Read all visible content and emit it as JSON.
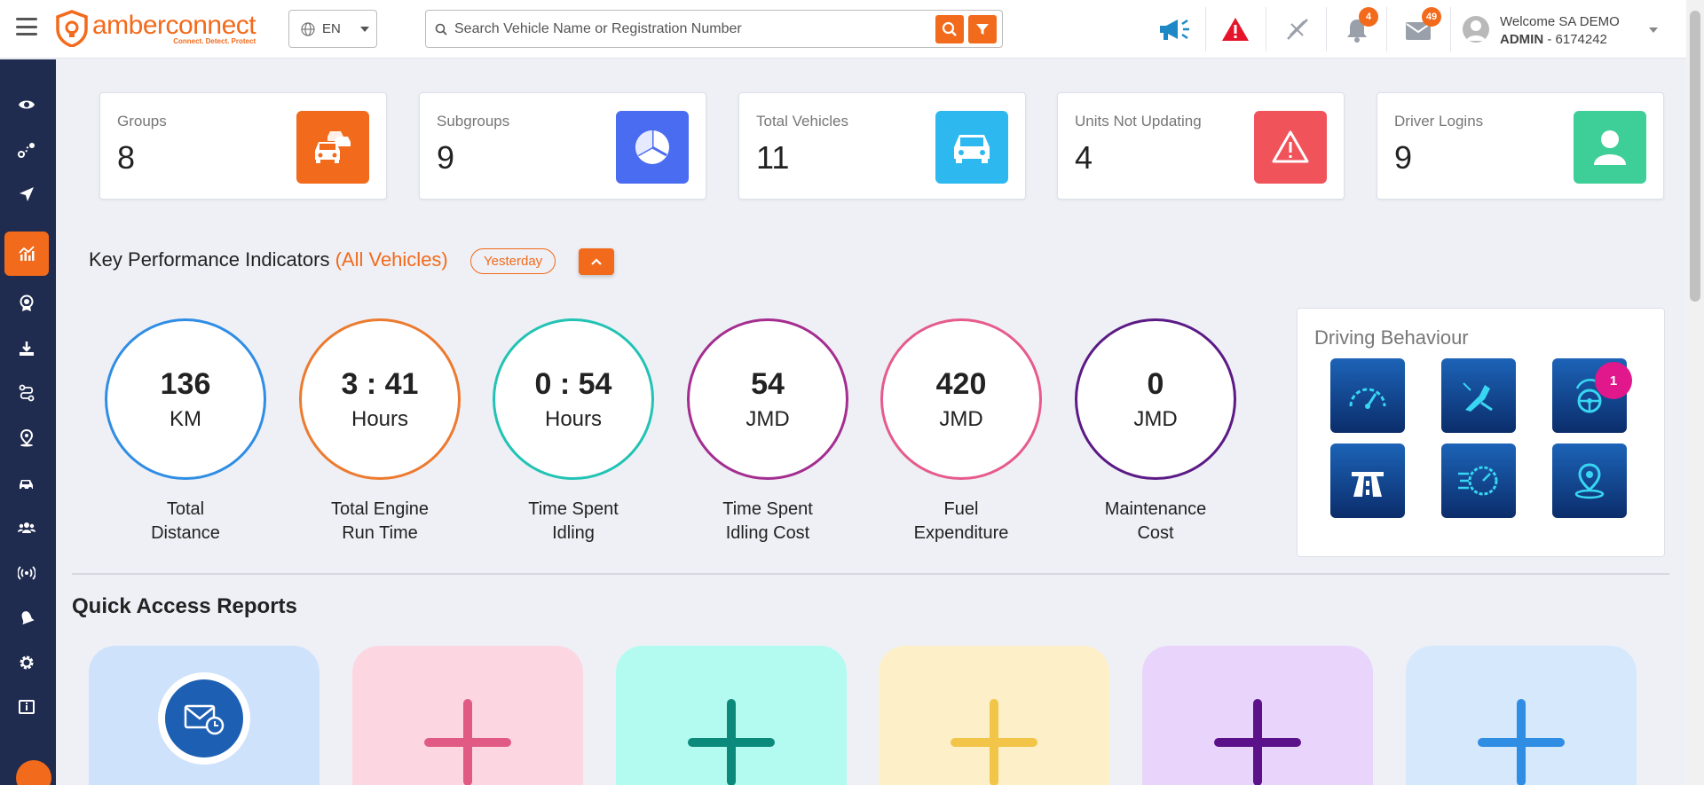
{
  "header": {
    "logo_name": "amberconnect",
    "logo_tagline": "Connect. Detect. Protect",
    "language": "EN",
    "search_placeholder": "Search Vehicle Name or Registration Number",
    "notifications_count": "4",
    "messages_count": "49",
    "user_welcome": "Welcome SA DEMO",
    "user_role": "ADMIN",
    "user_id": " - 6174242"
  },
  "sidebar": {
    "items": [
      {
        "icon": "eye-icon"
      },
      {
        "icon": "route-icon"
      },
      {
        "icon": "navigation-icon"
      },
      {
        "icon": "dashboard-chart-icon",
        "active": true
      },
      {
        "icon": "badge-icon"
      },
      {
        "icon": "download-icon"
      },
      {
        "icon": "trip-icon"
      },
      {
        "icon": "location-pin-icon"
      },
      {
        "icon": "vehicle-icon"
      },
      {
        "icon": "users-icon"
      },
      {
        "icon": "broadcast-icon"
      },
      {
        "icon": "alert-bell-icon"
      },
      {
        "icon": "settings-icon"
      },
      {
        "icon": "info-icon"
      }
    ]
  },
  "stats": [
    {
      "label": "Groups",
      "value": "8",
      "color": "#f26a1b",
      "icon": "cars-icon"
    },
    {
      "label": "Subgroups",
      "value": "9",
      "color": "#4a6cf0",
      "icon": "pie-icon"
    },
    {
      "label": "Total Vehicles",
      "value": "11",
      "color": "#2db9ef",
      "icon": "car-icon"
    },
    {
      "label": "Units Not Updating",
      "value": "4",
      "color": "#f0535a",
      "icon": "warning-icon"
    },
    {
      "label": "Driver Logins",
      "value": "9",
      "color": "#3ecf98",
      "icon": "person-icon"
    }
  ],
  "kpi": {
    "title": "Key Performance Indicators",
    "scope": "(All Vehicles)",
    "period": "Yesterday",
    "items": [
      {
        "value": "136",
        "unit": "KM",
        "label1": "Total",
        "label2": "Distance",
        "color": "#2f8de4"
      },
      {
        "value": "3 : 41",
        "unit": "Hours",
        "label1": "Total Engine",
        "label2": "Run Time",
        "color": "#ec7a2f"
      },
      {
        "value": "0 : 54",
        "unit": "Hours",
        "label1": "Time Spent",
        "label2": "Idling",
        "color": "#22c3b4"
      },
      {
        "value": "54",
        "unit": "JMD",
        "label1": "Time Spent",
        "label2": "Idling Cost",
        "color": "#a42d8f"
      },
      {
        "value": "420",
        "unit": "JMD",
        "label1": "Fuel",
        "label2": "Expenditure",
        "color": "#e65b8b"
      },
      {
        "value": "0",
        "unit": "JMD",
        "label1": "Maintenance",
        "label2": "Cost",
        "color": "#5b1a86"
      }
    ]
  },
  "driving_behaviour": {
    "title": "Driving Behaviour",
    "tiles": [
      {
        "icon": "speedometer-icon"
      },
      {
        "icon": "harsh-braking-icon"
      },
      {
        "icon": "harsh-cornering-icon",
        "badge": "1"
      },
      {
        "icon": "highway-icon"
      },
      {
        "icon": "acceleration-icon"
      },
      {
        "icon": "geofence-icon"
      }
    ]
  },
  "quick_access": {
    "title": "Quick Access Reports",
    "cards": [
      {
        "bg": "#cfe2fc",
        "icon": "scheduled-mail-icon"
      },
      {
        "bg": "#fcd7e2",
        "icon": "plus-icon",
        "color": "#e05a84"
      },
      {
        "bg": "#b3fbf0",
        "icon": "plus-icon",
        "color": "#0b8a7c"
      },
      {
        "bg": "#fdf0c8",
        "icon": "plus-icon",
        "color": "#f2c548"
      },
      {
        "bg": "#e9d5fb",
        "icon": "plus-icon",
        "color": "#5a1189"
      },
      {
        "bg": "#d6e8fc",
        "icon": "plus-icon",
        "color": "#2f8de4"
      }
    ]
  }
}
